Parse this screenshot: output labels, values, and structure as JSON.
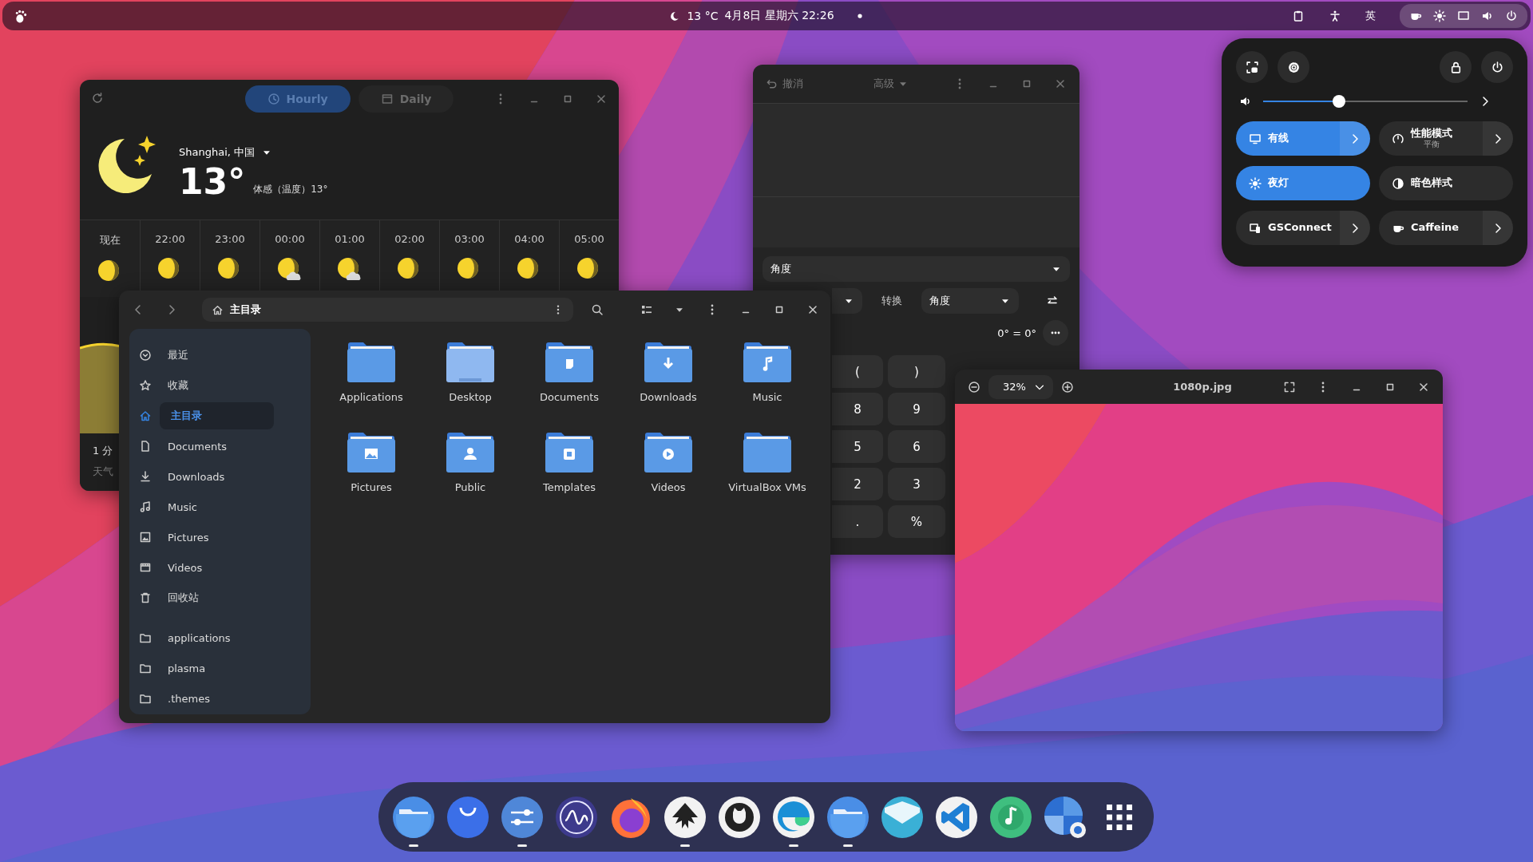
{
  "top_bar": {
    "weather": "13 °C",
    "clock": "4月8日 星期六 22:26",
    "input_method": "英"
  },
  "weather_window": {
    "tabs": [
      {
        "label": "Hourly",
        "kind": "clock",
        "selected": true
      },
      {
        "label": "Daily",
        "kind": "calendar",
        "selected": false
      }
    ],
    "location": "Shanghai, 中国",
    "temperature": "13°",
    "feels_like": "体感（温度）13°",
    "hours": [
      {
        "time": "现在",
        "cloudy": false
      },
      {
        "time": "22:00",
        "cloudy": false
      },
      {
        "time": "23:00",
        "cloudy": false
      },
      {
        "time": "00:00",
        "cloudy": true
      },
      {
        "time": "01:00",
        "cloudy": true
      },
      {
        "time": "02:00",
        "cloudy": false
      },
      {
        "time": "03:00",
        "cloudy": false
      },
      {
        "time": "04:00",
        "cloudy": false
      },
      {
        "time": "05:00",
        "cloudy": false
      }
    ],
    "updated": "1 分",
    "source": "天气"
  },
  "calculator": {
    "undo": "撤消",
    "mode": "高级",
    "category": "角度",
    "convert_label": "转换",
    "to_unit": "角度",
    "result": "0° = 0°",
    "keys": [
      [
        "(",
        ")"
      ],
      [
        "8",
        "9"
      ],
      [
        "5",
        "6"
      ],
      [
        "2",
        "3"
      ],
      [
        ".",
        "%"
      ]
    ]
  },
  "file_manager": {
    "path": "主目录",
    "places": [
      {
        "label": "最近",
        "kind": "recent",
        "selected": false
      },
      {
        "label": "收藏",
        "kind": "starred",
        "selected": false
      },
      {
        "label": "主目录",
        "kind": "home",
        "selected": true
      },
      {
        "label": "Documents",
        "kind": "document",
        "selected": false
      },
      {
        "label": "Downloads",
        "kind": "download",
        "selected": false
      },
      {
        "label": "Music",
        "kind": "music",
        "selected": false
      },
      {
        "label": "Pictures",
        "kind": "picture",
        "selected": false
      },
      {
        "label": "Videos",
        "kind": "video",
        "selected": false
      },
      {
        "label": "回收站",
        "kind": "trash",
        "selected": false
      }
    ],
    "bookmarks": [
      {
        "label": "applications",
        "kind": "folder",
        "selected": false
      },
      {
        "label": "plasma",
        "kind": "folder",
        "selected": false
      },
      {
        "label": ".themes",
        "kind": "folder",
        "selected": false
      }
    ],
    "files": [
      {
        "name": "Applications",
        "kind": "plain"
      },
      {
        "name": "Desktop",
        "kind": "desktop"
      },
      {
        "name": "Documents",
        "kind": "document"
      },
      {
        "name": "Downloads",
        "kind": "download"
      },
      {
        "name": "Music",
        "kind": "music"
      },
      {
        "name": "Pictures",
        "kind": "picture"
      },
      {
        "name": "Public",
        "kind": "person"
      },
      {
        "name": "Templates",
        "kind": "template"
      },
      {
        "name": "Videos",
        "kind": "video"
      },
      {
        "name": "VirtualBox VMs",
        "kind": "plain"
      }
    ]
  },
  "image_viewer": {
    "zoom": "32%",
    "title": "1080p.jpg"
  },
  "quick_settings": {
    "volume": {
      "level": 0.37
    },
    "toggles": [
      {
        "label": "有线",
        "kind": "wired",
        "on": true,
        "menu": true
      },
      {
        "label": "性能模式",
        "subtitle": "平衡",
        "kind": "power-mode",
        "on": false,
        "menu": true
      },
      {
        "label": "夜灯",
        "kind": "night-light",
        "on": true,
        "menu": false
      },
      {
        "label": "暗色样式",
        "kind": "dark-style",
        "on": false,
        "menu": false
      },
      {
        "label": "GSConnect",
        "kind": "phone",
        "on": false,
        "menu": true
      },
      {
        "label": "Caffeine",
        "kind": "cup",
        "on": false,
        "menu": true
      }
    ]
  },
  "dock": {
    "items": [
      {
        "kind": "folder",
        "running": true
      },
      {
        "kind": "bag",
        "running": false
      },
      {
        "kind": "sliders",
        "running": true
      },
      {
        "kind": "wave",
        "running": false
      },
      {
        "kind": "flame",
        "running": false
      },
      {
        "kind": "pen",
        "running": true
      },
      {
        "kind": "cat",
        "running": false
      },
      {
        "kind": "swirl",
        "running": true
      },
      {
        "kind": "folder",
        "running": true
      },
      {
        "kind": "mail",
        "running": false
      },
      {
        "kind": "ribbon",
        "running": false
      },
      {
        "kind": "note",
        "running": false
      },
      {
        "kind": "mosaic",
        "running": false
      },
      {
        "kind": "apps",
        "running": false
      }
    ]
  }
}
